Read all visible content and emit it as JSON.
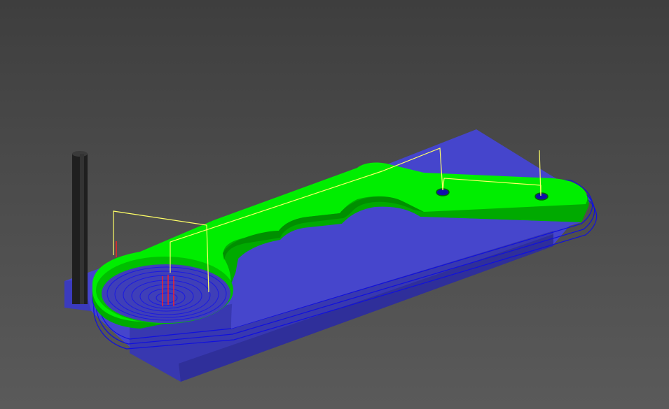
{
  "view": {
    "background_top": "#3e3e3e",
    "background_bottom": "#5a5a5a"
  },
  "colors": {
    "stock": "#4444cc",
    "stock_dark": "#3333aa",
    "stock_side": "#3a3ab8",
    "part_top": "#00ee00",
    "part_side": "#00aa00",
    "toolpath": "#1010dd",
    "rapid": "#ffff66",
    "plunge": "#ff3333",
    "tool": "#1a1a1a"
  },
  "scene": {
    "stock_name": "stock-block",
    "part_name": "wrench-part",
    "tool_name": "end-mill-tool",
    "features": [
      "large-bore-pocket",
      "scallop-recess-1",
      "scallop-recess-2",
      "small-hole-1",
      "small-hole-2"
    ]
  }
}
